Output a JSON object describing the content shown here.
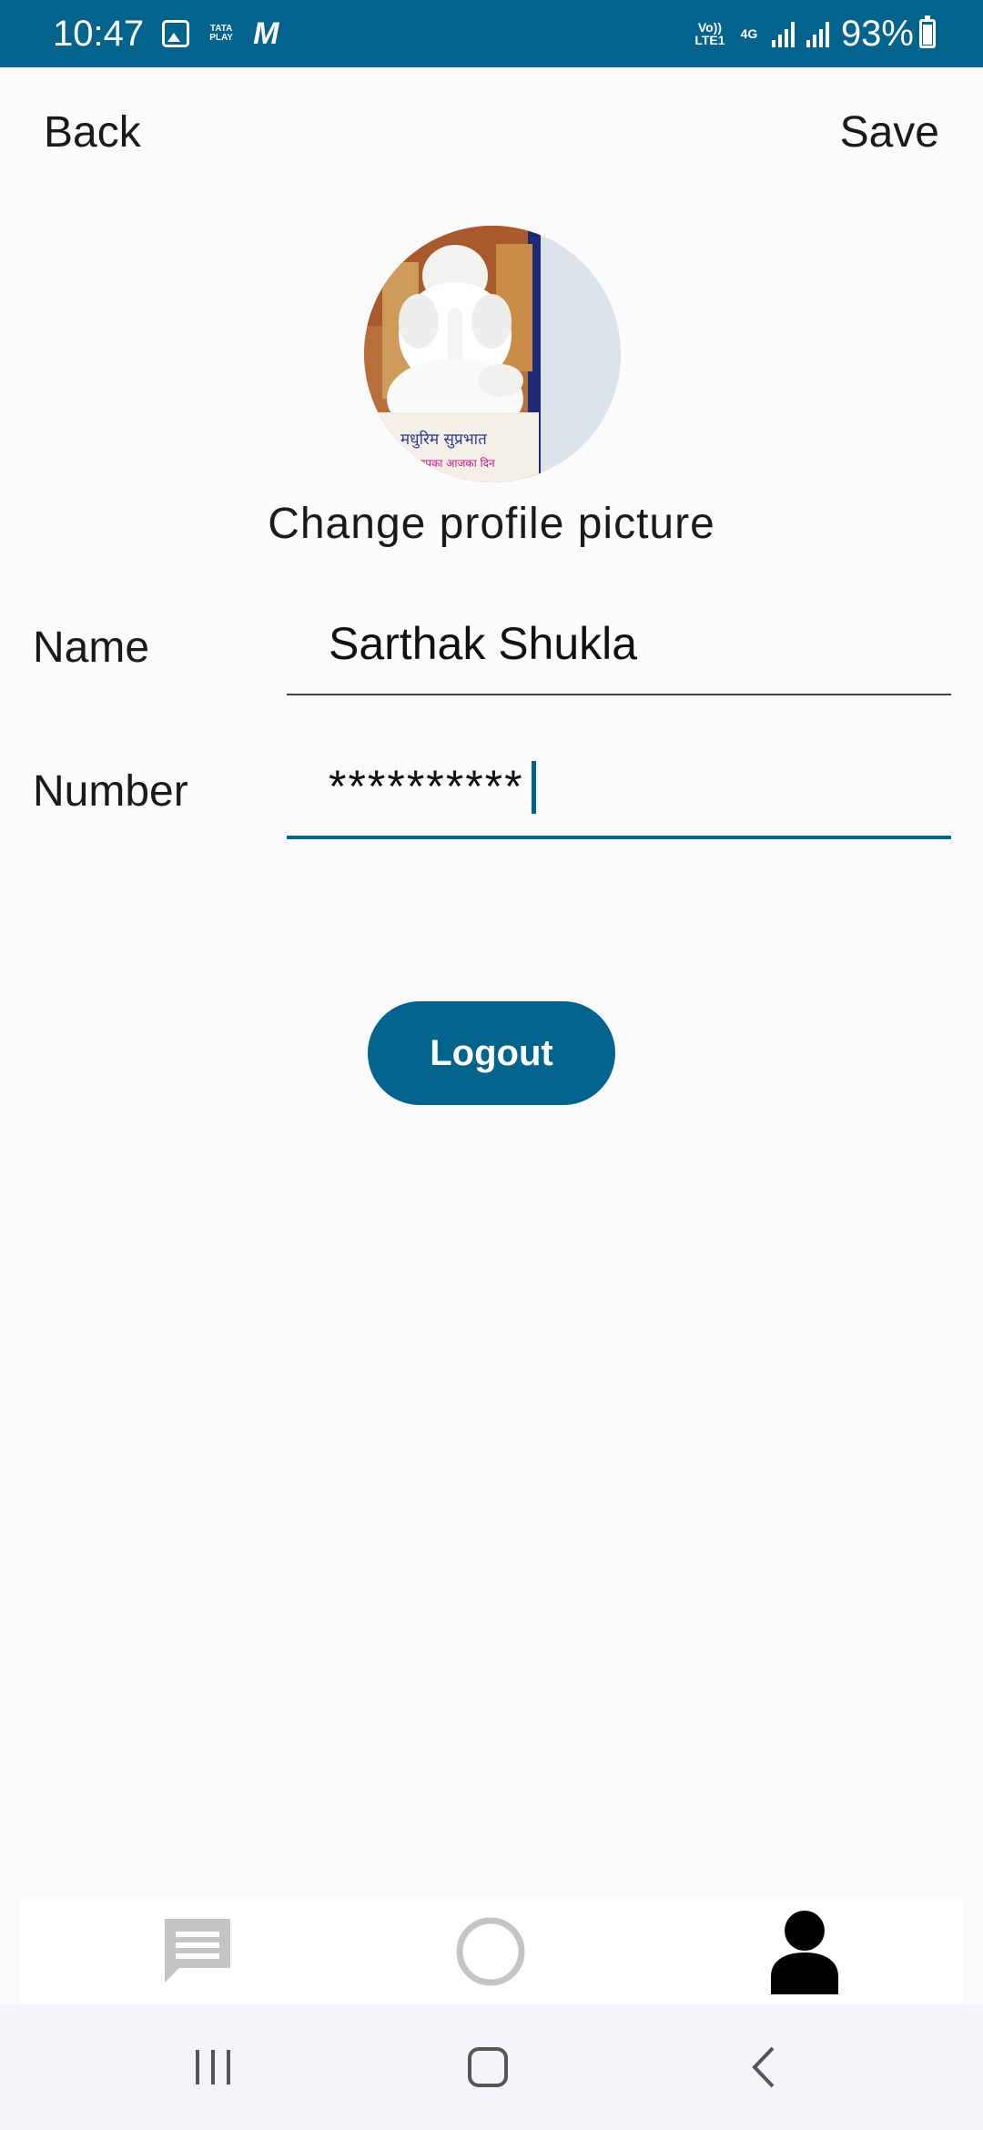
{
  "status_bar": {
    "time": "10:47",
    "carrier_icon_text": "TATA PLAY",
    "volte_text": "Vo)) LTE1",
    "network_text": "4G",
    "battery": "93%",
    "accent": "#02648c"
  },
  "header": {
    "back_label": "Back",
    "save_label": "Save"
  },
  "profile": {
    "avatar_text_top": "मधुरिम सुप्रभात",
    "avatar_text_bottom": "आपका आजका दिन",
    "change_picture_label": "Change profile picture"
  },
  "form": {
    "name_label": "Name",
    "name_value": "Sarthak Shukla",
    "number_label": "Number",
    "number_value": "**********"
  },
  "actions": {
    "logout_label": "Logout"
  },
  "bottom_nav": {
    "tabs": [
      {
        "icon": "chat-icon",
        "active": false
      },
      {
        "icon": "circle-icon",
        "active": false
      },
      {
        "icon": "person-icon",
        "active": true
      }
    ]
  },
  "system_nav": {
    "icons": [
      "recent-apps-icon",
      "home-icon",
      "back-icon"
    ]
  }
}
